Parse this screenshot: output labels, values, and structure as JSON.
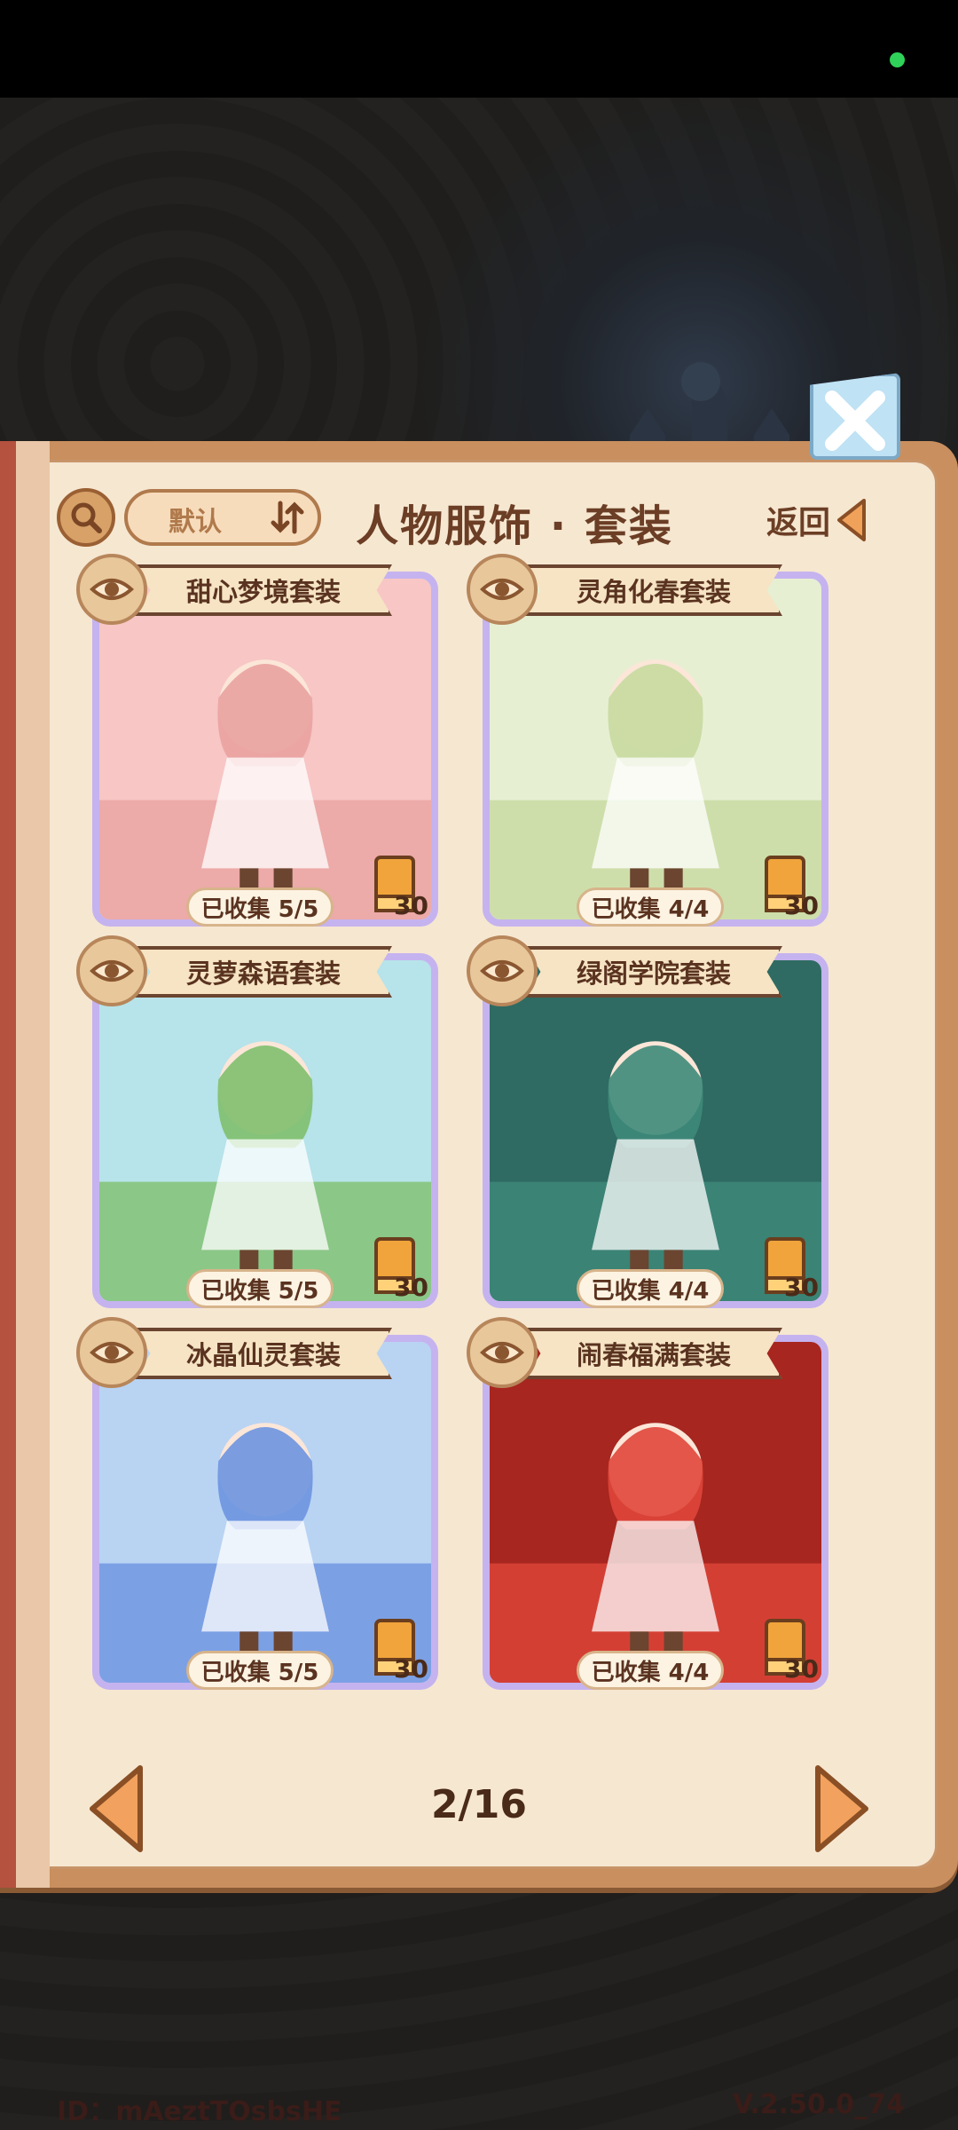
{
  "header": {
    "sort_label": "默认",
    "title": "人物服饰 · 套装",
    "back_label": "返回"
  },
  "outfits": [
    {
      "name": "甜心梦境套装",
      "collected": "已收集 5/5",
      "cost": "30",
      "theme": "pink-dessert",
      "colors": [
        "#f7c6c5",
        "#e9a2a0"
      ]
    },
    {
      "name": "灵角化春套装",
      "collected": "已收集 4/4",
      "cost": "30",
      "theme": "spring-garden",
      "colors": [
        "#e7efd3",
        "#c8d9a0"
      ]
    },
    {
      "name": "灵萝森语套装",
      "collected": "已收集 5/5",
      "cost": "30",
      "theme": "forest-elf",
      "colors": [
        "#b7e3ea",
        "#7fbf6e"
      ]
    },
    {
      "name": "绿阁学院套装",
      "collected": "已收集 4/4",
      "cost": "30",
      "theme": "academy-green",
      "colors": [
        "#2f6b62",
        "#3e8a7a"
      ]
    },
    {
      "name": "冰晶仙灵套装",
      "collected": "已收集 5/5",
      "cost": "30",
      "theme": "ice-fairy",
      "colors": [
        "#b9d3f3",
        "#6d93e0"
      ]
    },
    {
      "name": "闹春福满套装",
      "collected": "已收集 4/4",
      "cost": "30",
      "theme": "new-year-red",
      "colors": [
        "#a7261f",
        "#e0463a"
      ]
    }
  ],
  "pagination": {
    "label": "2/16"
  },
  "footer": {
    "id": "ID：mAeztTOsbsHE",
    "version": "V.2.50.0_74"
  }
}
